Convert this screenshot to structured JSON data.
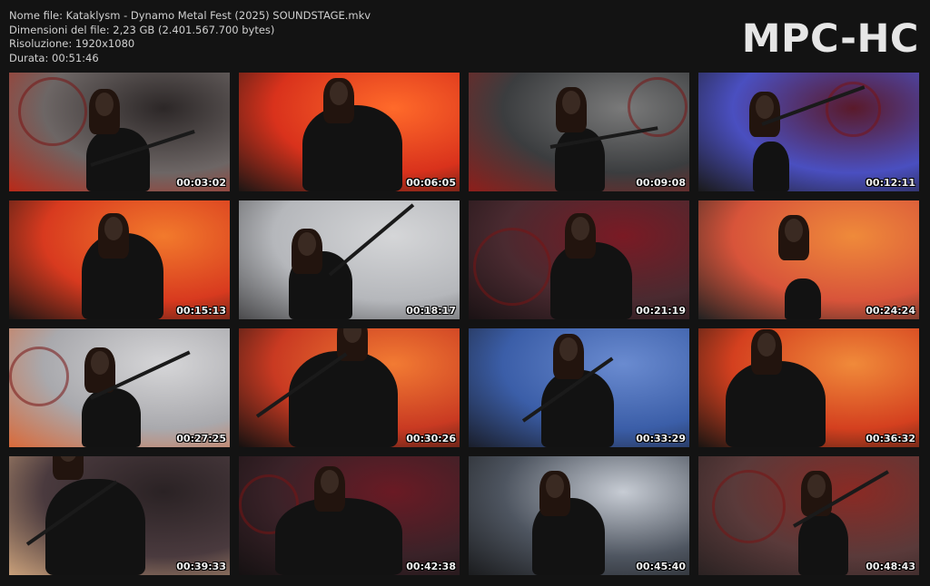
{
  "info": {
    "filename_line": "Nome file: Kataklysm - Dynamo Metal Fest (2025) SOUNDSTAGE.mkv",
    "size_line": "Dimensioni del file: 2,23 GB (2.401.567.700 bytes)",
    "resolution_line": "Risoluzione: 1920x1080",
    "duration_line": "Durata: 00:51:46"
  },
  "logo_text": "MPC-HC",
  "thumbnails": [
    {
      "timestamp": "00:03:02",
      "scene": "guitarist-headbang-dark-stage",
      "colors": [
        "#6d6665",
        "#2c2727",
        "#b92918"
      ]
    },
    {
      "timestamp": "00:06:05",
      "scene": "singer-red-backdrop",
      "colors": [
        "#d9321c",
        "#ff6a2a",
        "#1c1614"
      ]
    },
    {
      "timestamp": "00:09:08",
      "scene": "two-guitarists-smoke",
      "colors": [
        "#3b3d3f",
        "#7a7a7a",
        "#8f1e1a"
      ]
    },
    {
      "timestamp": "00:12:11",
      "scene": "wide-stage-blue-light",
      "colors": [
        "#4a4fc0",
        "#5a1a2a",
        "#1a1a1a"
      ]
    },
    {
      "timestamp": "00:15:13",
      "scene": "singer-mic-red-backdrop",
      "colors": [
        "#d83a1f",
        "#f27a2c",
        "#1b1513"
      ]
    },
    {
      "timestamp": "00:18:17",
      "scene": "guitarists-heavy-smoke",
      "colors": [
        "#b5b7bb",
        "#d5d6d8",
        "#4a4a4c"
      ]
    },
    {
      "timestamp": "00:21:19",
      "scene": "singer-dark-red-logo",
      "colors": [
        "#4a2a30",
        "#7a1a24",
        "#1a1214"
      ]
    },
    {
      "timestamp": "00:24:24",
      "scene": "wide-stage-crowd-drums",
      "colors": [
        "#d8543a",
        "#ef8a3a",
        "#222222"
      ]
    },
    {
      "timestamp": "00:27:25",
      "scene": "guitarist-smoke-amps",
      "colors": [
        "#a9a9ad",
        "#d6d6d8",
        "#d96a3a"
      ]
    },
    {
      "timestamp": "00:30:26",
      "scene": "guitarist-closeup-red",
      "colors": [
        "#c93a22",
        "#f27b33",
        "#141110"
      ]
    },
    {
      "timestamp": "00:33:29",
      "scene": "guitarist-blue-haze",
      "colors": [
        "#3b5ea8",
        "#6a8bd0",
        "#1a1e2a"
      ]
    },
    {
      "timestamp": "00:36:32",
      "scene": "drummer-cymbals-red",
      "colors": [
        "#d4401f",
        "#f08a3a",
        "#1a1512"
      ]
    },
    {
      "timestamp": "00:39:33",
      "scene": "guitar-closeup-dark",
      "colors": [
        "#4a3a3e",
        "#2a2224",
        "#c9a07a"
      ]
    },
    {
      "timestamp": "00:42:38",
      "scene": "singer-pointing-dark",
      "colors": [
        "#3a2228",
        "#6a1a24",
        "#151112"
      ]
    },
    {
      "timestamp": "00:45:40",
      "scene": "guitarist-stage-rig",
      "colors": [
        "#4e5560",
        "#c7ccd4",
        "#1b1c1e"
      ]
    },
    {
      "timestamp": "00:48:43",
      "scene": "guitarist-wide-red-logo",
      "colors": [
        "#5a3a3a",
        "#8a2a24",
        "#2a2222"
      ]
    }
  ]
}
